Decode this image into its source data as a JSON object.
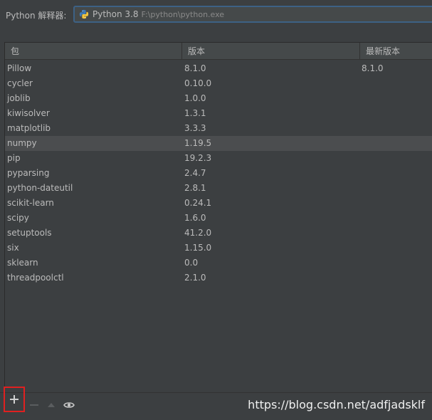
{
  "interpreter": {
    "label": "Python 解释器:",
    "name": "Python 3.8",
    "path": "F:\\python\\python.exe",
    "icon": "python-icon"
  },
  "table": {
    "columns": [
      "包",
      "版本",
      "最新版本"
    ],
    "rows": [
      {
        "package": "Pillow",
        "version": "8.1.0",
        "latest": "8.1.0"
      },
      {
        "package": "cycler",
        "version": "0.10.0",
        "latest": ""
      },
      {
        "package": "joblib",
        "version": "1.0.0",
        "latest": ""
      },
      {
        "package": "kiwisolver",
        "version": "1.3.1",
        "latest": ""
      },
      {
        "package": "matplotlib",
        "version": "3.3.3",
        "latest": ""
      },
      {
        "package": "numpy",
        "version": "1.19.5",
        "latest": ""
      },
      {
        "package": "pip",
        "version": "19.2.3",
        "latest": ""
      },
      {
        "package": "pyparsing",
        "version": "2.4.7",
        "latest": ""
      },
      {
        "package": "python-dateutil",
        "version": "2.8.1",
        "latest": ""
      },
      {
        "package": "scikit-learn",
        "version": "0.24.1",
        "latest": ""
      },
      {
        "package": "scipy",
        "version": "1.6.0",
        "latest": ""
      },
      {
        "package": "setuptools",
        "version": "41.2.0",
        "latest": ""
      },
      {
        "package": "six",
        "version": "1.15.0",
        "latest": ""
      },
      {
        "package": "sklearn",
        "version": "0.0",
        "latest": ""
      },
      {
        "package": "threadpoolctl",
        "version": "2.1.0",
        "latest": ""
      }
    ],
    "selected_index": 5
  },
  "toolbar": {
    "add_icon": "plus-icon",
    "remove_icon": "minus-icon",
    "upgrade_icon": "arrow-up-icon",
    "show_icon": "eye-icon"
  },
  "watermark": "https://blog.csdn.net/adfjadsklf",
  "colors": {
    "background": "#3c3f41",
    "header": "#45494a",
    "selected_row": "#4b4d4f",
    "focus_border": "#3d6185",
    "highlight_box": "#e02020"
  }
}
